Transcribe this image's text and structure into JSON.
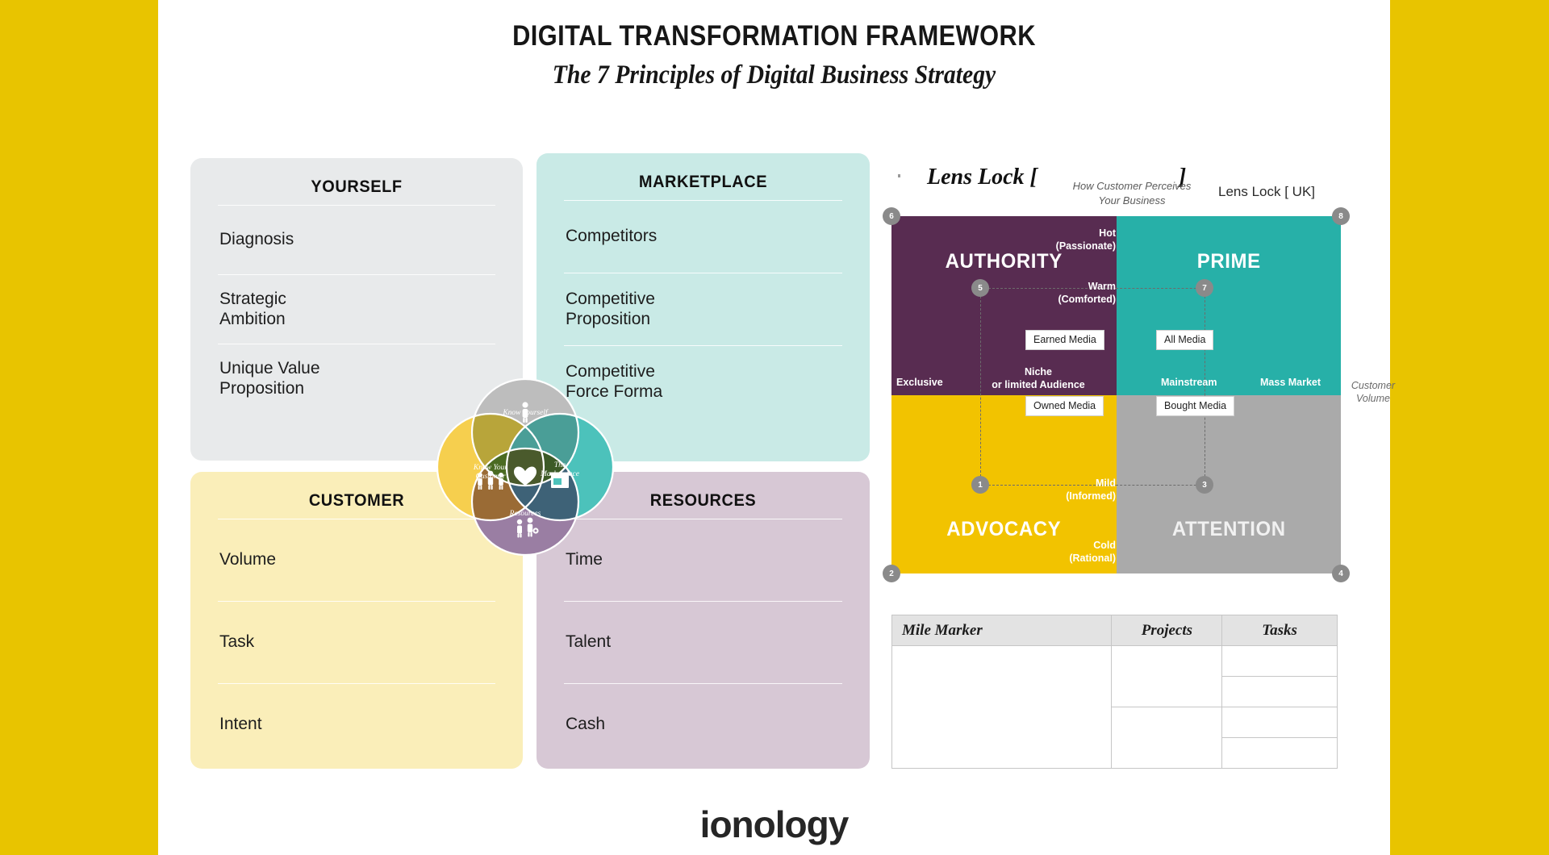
{
  "page": {
    "title": "DIGITAL TRANSFORMATION FRAMEWORK",
    "subtitle": "The 7 Principles of Digital Business Strategy",
    "logo": "ionology",
    "band_color": "#e8c400"
  },
  "panels": [
    {
      "key": "yourself",
      "title": "YOURSELF",
      "bg": "#e8eaeb",
      "rows": [
        "Diagnosis",
        "Strategic\nAmbition",
        "Unique Value\nProposition"
      ]
    },
    {
      "key": "marketplace",
      "title": "MARKETPLACE",
      "bg": "#c9eae6",
      "rows": [
        "Competitors",
        "Competitive\nProposition",
        "Competitive\nForce Forma"
      ]
    },
    {
      "key": "customer",
      "title": "CUSTOMER",
      "bg": "#faeeb9",
      "rows": [
        "Volume",
        "Task",
        "Intent"
      ]
    },
    {
      "key": "resources",
      "title": "RESOURCES",
      "bg": "#d7c8d5",
      "rows": [
        "Time",
        "Talent",
        "Cash"
      ]
    }
  ],
  "venn": {
    "circles": [
      {
        "label": "Know Yourself",
        "icon": "person-icon",
        "color": "#bdbdbd",
        "position": "top"
      },
      {
        "label": "Know Your Customer",
        "icon": "people-group-icon",
        "color": "#f6cf4e",
        "position": "left"
      },
      {
        "label": "The Marketplace",
        "icon": "shop-icon",
        "color": "#4cc2bb",
        "position": "right"
      },
      {
        "label": "Resources",
        "icon": "people-gear-icon",
        "color": "#9a7ea3",
        "position": "bottom"
      }
    ],
    "center_icon": "heart-icon"
  },
  "lenslock": {
    "heading_prefix": "Lens Lock [",
    "heading_suffix": "]",
    "region_label": "Lens Lock [ UK]",
    "axis_caption": "How Customer Perceives\nYour Business",
    "y_axis_label": "Customer\nVolume",
    "quadrants": [
      {
        "name": "AUTHORITY",
        "color": "#582c51"
      },
      {
        "name": "PRIME",
        "color": "#27b0a8"
      },
      {
        "name": "ADVOCACY",
        "color": "#f2c300"
      },
      {
        "name": "ATTENTION",
        "color": "#aaaaaa"
      }
    ],
    "y_ticks": [
      "Hot\n(Passionate)",
      "Warm\n(Comforted)",
      "Mild\n(Informed)",
      "Cold\n(Rational)"
    ],
    "x_ticks": [
      "Exclusive",
      "Niche\nor limited Audience",
      "Mainstream",
      "Mass Market"
    ],
    "media_boxes": [
      "Earned Media",
      "All Media",
      "Owned Media",
      "Bought Media"
    ],
    "nodes": [
      "1",
      "2",
      "3",
      "4",
      "5",
      "6",
      "7",
      "8"
    ]
  },
  "mile_table": {
    "headers": [
      "Mile Marker",
      "Projects",
      "Tasks"
    ],
    "mile_cells": [
      ""
    ],
    "project_cells": [
      "",
      ""
    ],
    "task_cells": [
      "",
      "",
      "",
      ""
    ]
  }
}
